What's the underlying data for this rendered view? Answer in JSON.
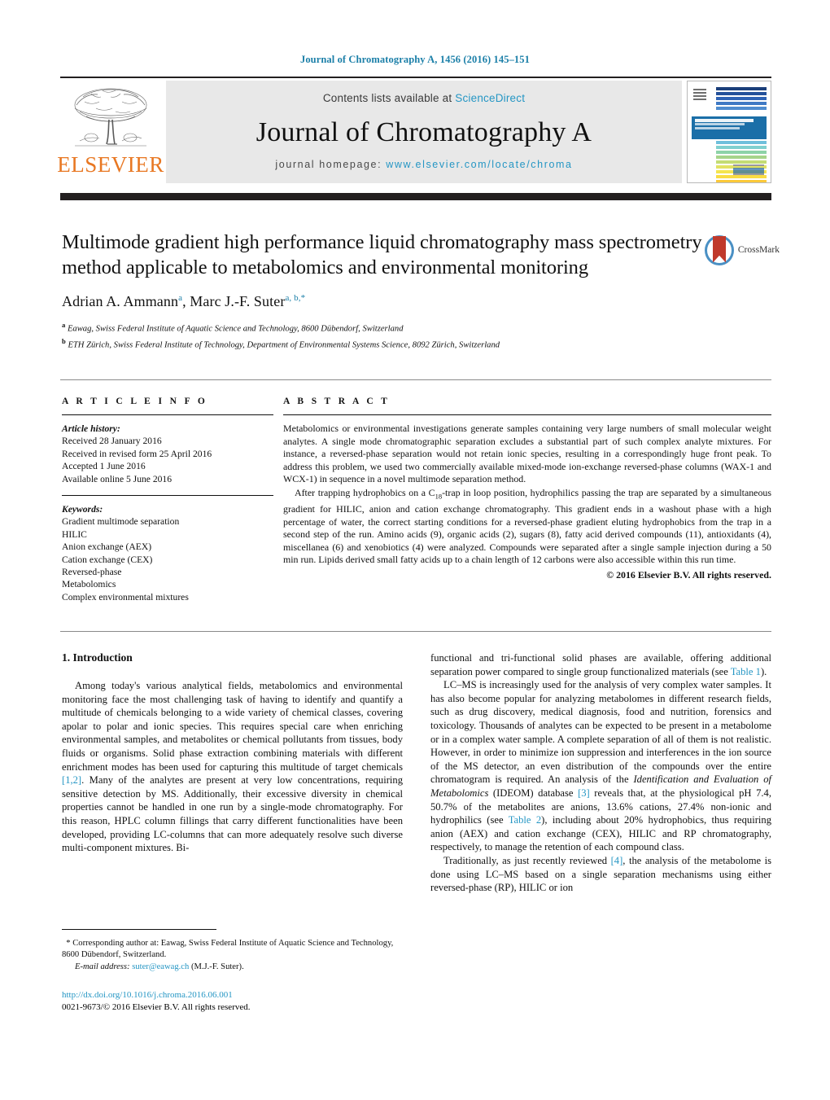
{
  "running_head": "Journal of Chromatography A, 1456 (2016) 145–151",
  "masthead": {
    "publisher": "ELSEVIER",
    "contents_prefix": "Contents lists available at ",
    "contents_link": "ScienceDirect",
    "journal_title": "Journal of Chromatography A",
    "homepage_prefix": "journal homepage: ",
    "homepage_link": "www.elsevier.com/locate/chroma"
  },
  "crossmark": {
    "label": "CrossMark"
  },
  "title": "Multimode gradient high performance liquid chromatography mass spectrometry method applicable to metabolomics and environmental monitoring",
  "authors": {
    "a1_name": "Adrian A. Ammann",
    "a1_sup": "a",
    "sep": ", ",
    "a2_name": "Marc J.-F. Suter",
    "a2_sup": "a, b,",
    "a2_star": "*"
  },
  "affiliations": [
    {
      "sup": "a",
      "text": "Eawag, Swiss Federal Institute of Aquatic Science and Technology, 8600 Dübendorf, Switzerland"
    },
    {
      "sup": "b",
      "text": "ETH Zürich, Swiss Federal Institute of Technology, Department of Environmental Systems Science, 8092 Zürich, Switzerland"
    }
  ],
  "article_info": {
    "heading": "A R T I C L E   I N F O",
    "history_label": "Article history:",
    "history": [
      "Received 28 January 2016",
      "Received in revised form 25 April 2016",
      "Accepted 1 June 2016",
      "Available online 5 June 2016"
    ],
    "keywords_label": "Keywords:",
    "keywords": [
      "Gradient multimode separation",
      "HILIC",
      "Anion exchange (AEX)",
      "Cation exchange (CEX)",
      "Reversed-phase",
      "Metabolomics",
      "Complex environmental mixtures"
    ]
  },
  "abstract": {
    "heading": "A B S T R A C T",
    "para1": "Metabolomics or environmental investigations generate samples containing very large numbers of small molecular weight analytes. A single mode chromatographic separation excludes a substantial part of such complex analyte mixtures. For instance, a reversed-phase separation would not retain ionic species, resulting in a correspondingly huge front peak. To address this problem, we used two commercially available mixed-mode ion-exchange reversed-phase columns (WAX-1 and WCX-1) in sequence in a novel multimode separation method.",
    "para2_pre": "After trapping hydrophobics on a C",
    "para2_sub": "18",
    "para2_post": "-trap in loop position, hydrophilics passing the trap are separated by a simultaneous gradient for HILIC, anion and cation exchange chromatography. This gradient ends in a washout phase with a high percentage of water, the correct starting conditions for a reversed-phase gradient eluting hydrophobics from the trap in a second step of the run. Amino acids (9), organic acids (2), sugars (8), fatty acid derived compounds (11), antioxidants (4), miscellanea (6) and xenobiotics (4) were analyzed. Compounds were separated after a single sample injection during a 50 min run. Lipids derived small fatty acids up to a chain length of 12 carbons were also accessible within this run time.",
    "copyright": "© 2016 Elsevier B.V. All rights reserved."
  },
  "section1": {
    "heading": "1. Introduction",
    "left_p1_a": "Among today's various analytical fields, metabolomics and environmental monitoring face the most challenging task of having to identify and quantify a multitude of chemicals belonging to a wide variety of chemical classes, covering apolar to polar and ionic species. This requires special care when enriching environmental samples, and metabolites or chemical pollutants from tissues, body fluids or organisms. Solid phase extraction combining materials with different enrichment modes has been used for capturing this multitude of target chemicals ",
    "left_ref1": "[1,2]",
    "left_p1_b": ". Many of the analytes are present at very low concentrations, requiring sensitive detection by MS. Additionally, their excessive diversity in chemical properties cannot be handled in one run by a single-mode chromatography. For this reason, HPLC column fillings that carry different functionalities have been developed, providing LC-columns that can more adequately resolve such diverse multi-component mixtures. Bi-",
    "right_p1_cont_a": "functional and tri-functional solid phases are available, offering additional separation power compared to single group functionalized materials (see ",
    "right_table1": "Table 1",
    "right_p1_cont_b": ").",
    "right_p2_a": "LC–MS is increasingly used for the analysis of very complex water samples. It has also become popular for analyzing metabolomes in different research fields, such as drug discovery, medical diagnosis, food and nutrition, forensics and toxicology. Thousands of analytes can be expected to be present in a metabolome or in a complex water sample. A complete separation of all of them is not realistic. However, in order to minimize ion suppression and interferences in the ion source of the MS detector, an even distribution of the compounds over the entire chromatogram is required. An analysis of the ",
    "right_p2_ital": "Identification and Evaluation of Metabolomics",
    "right_p2_b": " (IDEOM) database ",
    "right_ref3": "[3]",
    "right_p2_c": " reveals that, at the physiological pH 7.4, 50.7% of the metabolites are anions, 13.6% cations, 27.4% non-ionic and hydrophilics (see ",
    "right_table2": "Table 2",
    "right_p2_d": "), including about 20% hydrophobics, thus requiring anion (AEX) and cation exchange (CEX), HILIC and RP chromatography, respectively, to manage the retention of each compound class.",
    "right_p3_a": "Traditionally, as just recently reviewed ",
    "right_ref4": "[4]",
    "right_p3_b": ", the analysis of the metabolome is done using LC–MS based on a single separation mechanisms using either reversed-phase (RP), HILIC or ion"
  },
  "footnote": {
    "star": "*",
    "corr_text": " Corresponding author at: Eawag, Swiss Federal Institute of Aquatic Science and Technology, 8600 Dübendorf, Switzerland.",
    "email_label": "E-mail address:",
    "email": "suter@eawag.ch",
    "email_suffix": " (M.J.-F. Suter)."
  },
  "doi_block": {
    "doi": "http://dx.doi.org/10.1016/j.chroma.2016.06.001",
    "issn": "0021-9673/© 2016 Elsevier B.V. All rights reserved."
  },
  "colors": {
    "link": "#2596c4",
    "running_head": "#1b7fa8",
    "elsevier_orange": "#E87722",
    "dark_bar": "#231f20",
    "band_gray": "#e8e8e8"
  }
}
